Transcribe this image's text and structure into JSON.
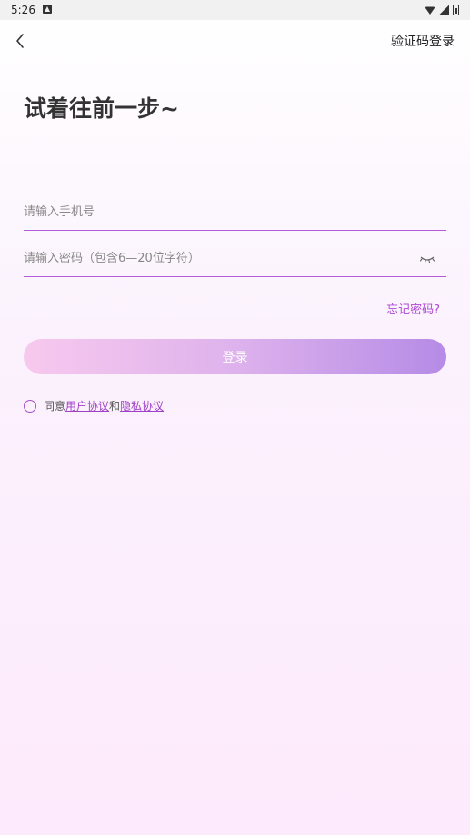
{
  "status_bar": {
    "time": "5:26"
  },
  "header": {
    "back_icon": "chevron-left-icon",
    "sms_login_label": "验证码登录"
  },
  "title": "试着往前一步~",
  "form": {
    "phone_placeholder": "请输入手机号",
    "phone_value": "",
    "password_placeholder": "请输入密码（包含6—20位字符）",
    "password_value": "",
    "eye_icon": "eye-closed-icon",
    "forgot_label": "忘记密码?",
    "login_label": "登录"
  },
  "agreement": {
    "prefix": "同意",
    "user_agreement": "用户协议",
    "conjunction": "和",
    "privacy_agreement": "隐私协议",
    "checked": false
  },
  "colors": {
    "accent": "#b04ad4",
    "button_gradient_start": "#f7c9ee",
    "button_gradient_end": "#b58be6"
  }
}
